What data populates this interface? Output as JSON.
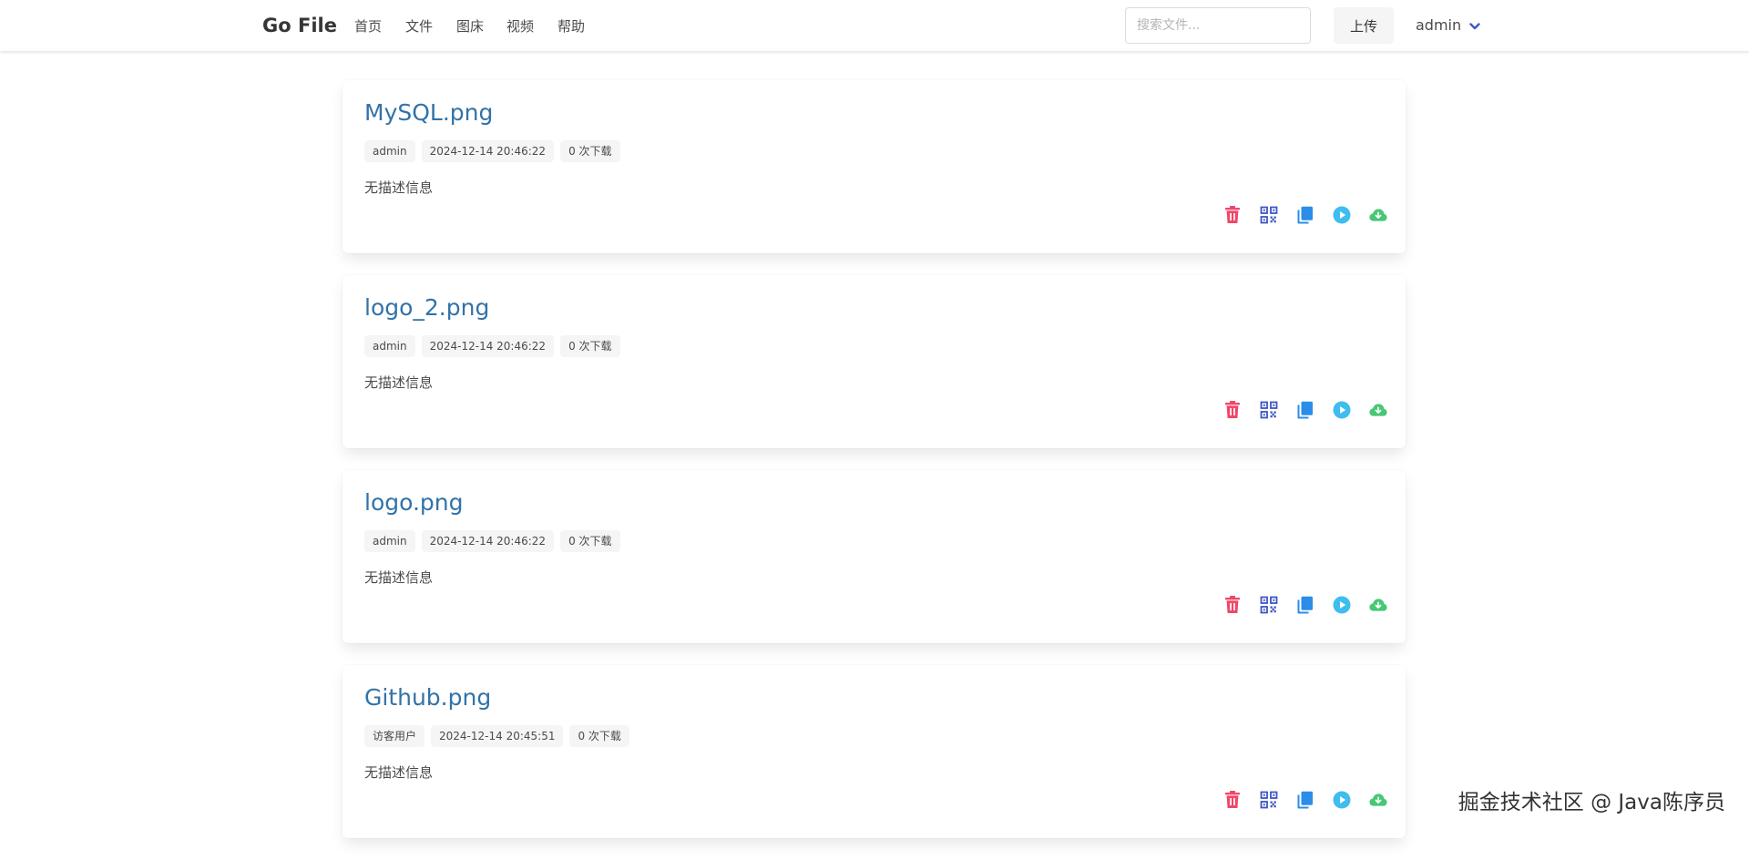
{
  "navbar": {
    "brand": "Go File",
    "links": [
      "首页",
      "文件",
      "图床",
      "视频",
      "帮助"
    ],
    "search_placeholder": "搜索文件...",
    "upload_label": "上传",
    "user_name": "admin"
  },
  "files": [
    {
      "name": "MySQL.png",
      "tags": [
        "admin",
        "2024-12-14 20:46:22",
        "0 次下载"
      ],
      "description": "无描述信息"
    },
    {
      "name": "logo_2.png",
      "tags": [
        "admin",
        "2024-12-14 20:46:22",
        "0 次下载"
      ],
      "description": "无描述信息"
    },
    {
      "name": "logo.png",
      "tags": [
        "admin",
        "2024-12-14 20:46:22",
        "0 次下载"
      ],
      "description": "无描述信息"
    },
    {
      "name": "Github.png",
      "tags": [
        "访客用户",
        "2024-12-14 20:45:51",
        "0 次下载"
      ],
      "description": "无描述信息"
    }
  ],
  "actions": [
    {
      "icon": "trash-icon",
      "color": "#f14668"
    },
    {
      "icon": "qrcode-icon",
      "color": "#3e56c4"
    },
    {
      "icon": "copy-icon",
      "color": "#2b8de8"
    },
    {
      "icon": "play-icon",
      "color": "#3ebdf0"
    },
    {
      "icon": "cloud-download-icon",
      "color": "#48c774"
    }
  ],
  "colors": {
    "title_link": "#3273a8",
    "tag_background": "#f5f5f5"
  },
  "watermark": "掘金技术社区 @ Java陈序员"
}
